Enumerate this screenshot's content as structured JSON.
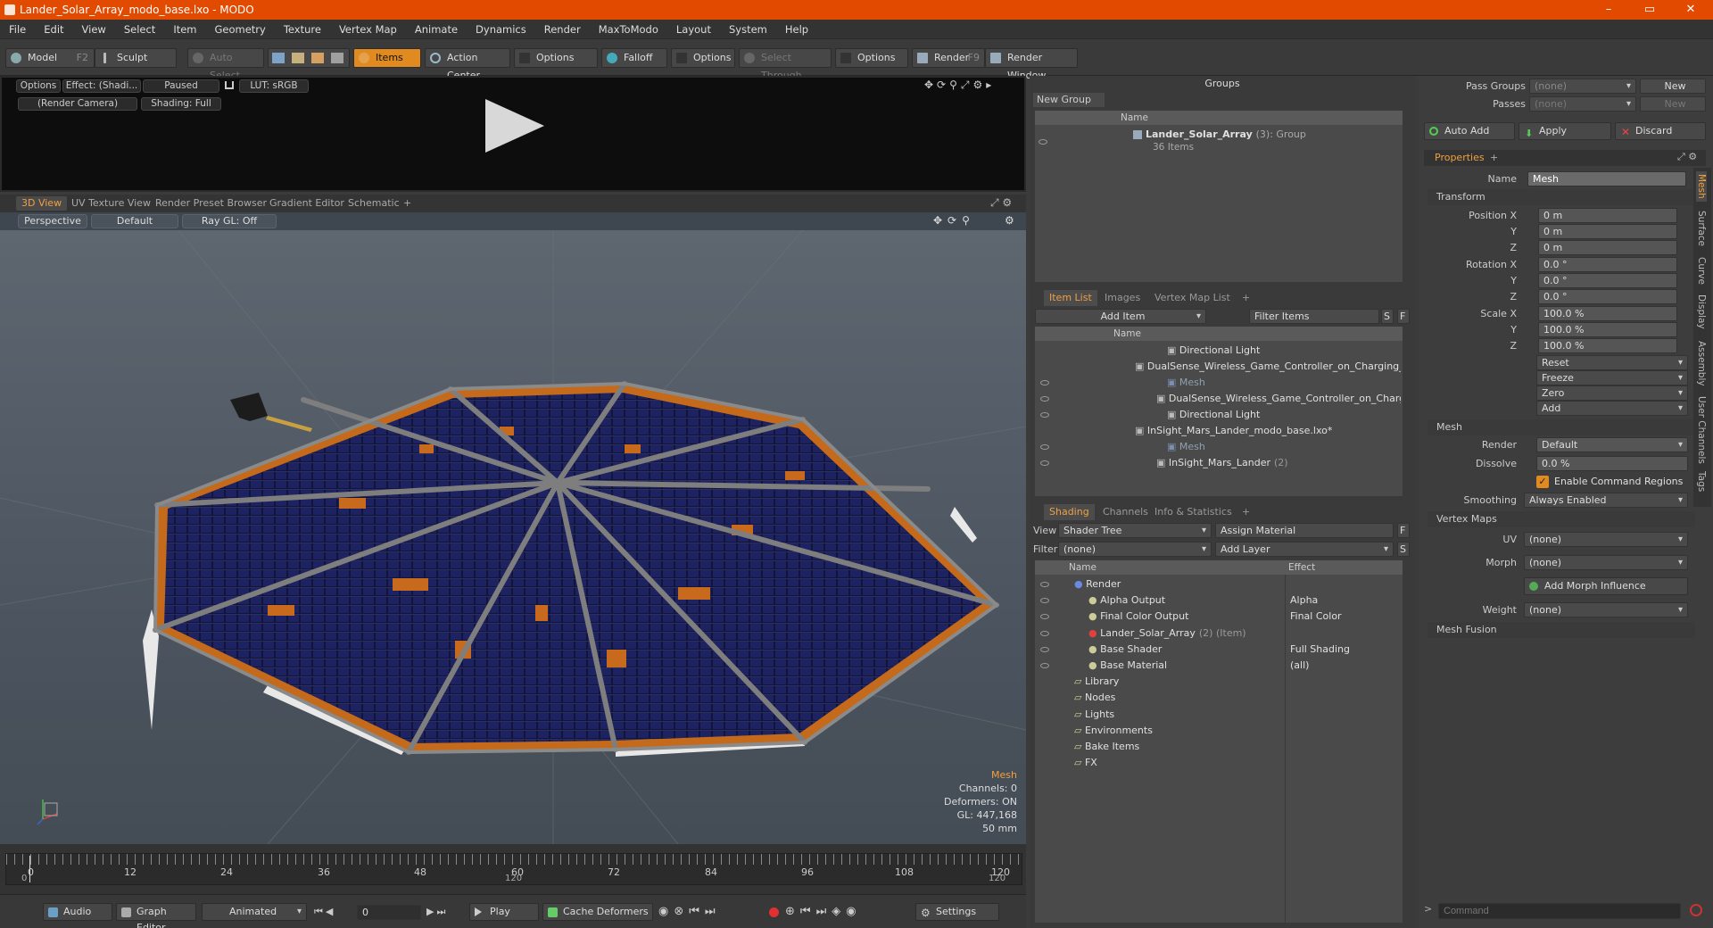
{
  "window": {
    "title": "Lander_Solar_Array_modo_base.lxo - MODO",
    "minimize": "–",
    "maximize": "▭",
    "close": "✕"
  },
  "menu": [
    "File",
    "Edit",
    "View",
    "Select",
    "Item",
    "Geometry",
    "Texture",
    "Vertex Map",
    "Animate",
    "Dynamics",
    "Render",
    "MaxToModo",
    "Layout",
    "System",
    "Help"
  ],
  "toolbar": {
    "model": "Model",
    "model_key": "F2",
    "sculpt": "Sculpt",
    "auto_select": "Auto Select",
    "items": "Items",
    "action_center": "Action Center",
    "options1": "Options",
    "falloff": "Falloff",
    "options2": "Options",
    "select_through": "Select Through",
    "options3": "Options",
    "render": "Render",
    "render_key": "F9",
    "render_window": "Render Window"
  },
  "preview": {
    "options": "Options",
    "effect": "Effect: (Shadi...",
    "paused": "Paused",
    "lut": "LUT: sRGB",
    "camera": "(Render Camera)",
    "shading": "Shading: Full"
  },
  "viewport": {
    "tabs": [
      "3D View",
      "UV Texture View",
      "Render Preset Browser",
      "Gradient Editor",
      "Schematic",
      "+"
    ],
    "perspective": "Perspective",
    "default": "Default",
    "raygl": "Ray GL: Off",
    "info": {
      "type": "Mesh",
      "channels": "Channels: 0",
      "deformers": "Deformers: ON",
      "gl": "GL: 447,168",
      "lens": "50 mm"
    }
  },
  "timeline": {
    "ticks": [
      "0",
      "12",
      "24",
      "36",
      "48",
      "60",
      "72",
      "84",
      "96",
      "108",
      "120"
    ],
    "bottom_ticks": [
      "0",
      "120",
      "120"
    ]
  },
  "bottombar": {
    "audio": "Audio",
    "graph_editor": "Graph Editor",
    "animated": "Animated",
    "frame": "0",
    "play": "Play",
    "cache": "Cache Deformers",
    "settings": "Settings"
  },
  "groups": {
    "title": "Groups",
    "new_group": "New Group",
    "col_name": "Name",
    "item_name": "Lander_Solar_Array",
    "item_count": "(3)",
    "item_type": ": Group",
    "item_sub": "36 Items"
  },
  "itemlist": {
    "tabs": [
      "Item List",
      "Images",
      "Vertex Map List",
      "+"
    ],
    "add_item": "Add Item",
    "filter": "Filter Items",
    "s": "S",
    "f": "F",
    "col_name": "Name",
    "rows": [
      {
        "text": "Directional Light",
        "indent": 4,
        "dim": false,
        "eye": false
      },
      {
        "text": "DualSense_Wireless_Game_Controller_on_Charging_Statio...",
        "indent": 1,
        "dim": false,
        "eye": false
      },
      {
        "text": "Mesh",
        "indent": 4,
        "dim": true,
        "eye": true
      },
      {
        "text": "DualSense_Wireless_Game_Controller_on_Charging_Sta...",
        "indent": 3,
        "dim": false,
        "eye": true
      },
      {
        "text": "Directional Light",
        "indent": 4,
        "dim": false,
        "eye": true
      },
      {
        "text": "InSight_Mars_Lander_modo_base.lxo*",
        "indent": 1,
        "dim": false,
        "eye": false
      },
      {
        "text": "Mesh",
        "indent": 4,
        "dim": true,
        "eye": true
      },
      {
        "text": "InSight_Mars_Lander",
        "suffix": "(2)",
        "indent": 3,
        "dim": false,
        "eye": true
      }
    ]
  },
  "shading": {
    "tabs": [
      "Shading",
      "Channels",
      "Info & Statistics",
      "+"
    ],
    "view_label": "View",
    "view_value": "Shader Tree",
    "assign_material": "Assign Material",
    "f": "F",
    "filter_label": "Filter",
    "filter_value": "(none)",
    "add_layer": "Add Layer",
    "s": "S",
    "col_name": "Name",
    "col_effect": "Effect",
    "rows": [
      {
        "name": "Render",
        "effect": "",
        "indent": 0,
        "eye": true
      },
      {
        "name": "Alpha Output",
        "effect": "Alpha",
        "indent": 1,
        "eye": true
      },
      {
        "name": "Final Color Output",
        "effect": "Final Color",
        "indent": 1,
        "eye": true
      },
      {
        "name": "Lander_Solar_Array",
        "suffix": "(2) (Item)",
        "effect": "",
        "indent": 1,
        "eye": true
      },
      {
        "name": "Base Shader",
        "effect": "Full Shading",
        "indent": 1,
        "eye": true
      },
      {
        "name": "Base Material",
        "effect": "(all)",
        "indent": 1,
        "eye": true
      },
      {
        "name": "Library",
        "effect": "",
        "indent": 0,
        "eye": false
      },
      {
        "name": "Nodes",
        "effect": "",
        "indent": 0,
        "eye": false
      },
      {
        "name": "Lights",
        "effect": "",
        "indent": 0,
        "eye": false
      },
      {
        "name": "Environments",
        "effect": "",
        "indent": 0,
        "eye": false
      },
      {
        "name": "Bake Items",
        "effect": "",
        "indent": 0,
        "eye": false
      },
      {
        "name": "FX",
        "effect": "",
        "indent": 0,
        "eye": false
      }
    ]
  },
  "right": {
    "pass_groups": "Pass Groups",
    "pass_groups_value": "(none)",
    "new1": "New",
    "passes": "Passes",
    "passes_value": "(none)",
    "new2": "New",
    "auto_add": "Auto Add",
    "apply": "Apply",
    "discard": "Discard",
    "properties": "Properties",
    "plus": "+",
    "name_label": "Name",
    "name_value": "Mesh",
    "transform": "Transform",
    "pos_x": "Position X",
    "y": "Y",
    "z": "Z",
    "rot_x": "Rotation X",
    "scale_x": "Scale X",
    "pos_val": "0 m",
    "rot_val": "0.0 °",
    "scale_val": "100.0 %",
    "reset": "Reset",
    "freeze": "Freeze",
    "zero": "Zero",
    "add": "Add",
    "mesh": "Mesh",
    "render_label": "Render",
    "render_value": "Default",
    "dissolve_label": "Dissolve",
    "dissolve_value": "0.0 %",
    "enable_cmd": "Enable Command Regions",
    "smoothing_label": "Smoothing",
    "smoothing_value": "Always Enabled",
    "vertex_maps": "Vertex Maps",
    "uv_label": "UV",
    "uv_value": "(none)",
    "morph_label": "Morph",
    "morph_value": "(none)",
    "add_morph": "Add Morph Influence",
    "weight_label": "Weight",
    "weight_value": "(none)",
    "mesh_fusion": "Mesh Fusion",
    "side_tabs": [
      "Mesh",
      "Surface",
      "Curve",
      "Display",
      "Assembly",
      "User Channels",
      "Tags"
    ],
    "command_placeholder": "Command"
  },
  "colors": {
    "accent": "#f0a040",
    "titlebar": "#e24a00"
  }
}
